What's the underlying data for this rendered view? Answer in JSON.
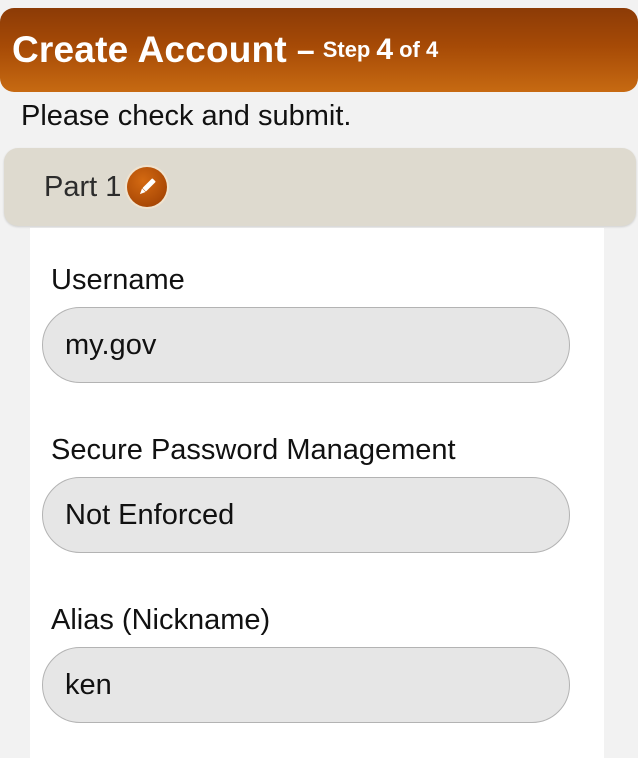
{
  "header": {
    "title": "Create Account",
    "dash": "–",
    "step_word": "Step",
    "step_current": "4",
    "step_of": "of 4"
  },
  "instructions": "Please check and submit.",
  "section": {
    "label": "Part 1",
    "edit_icon": "pencil-icon"
  },
  "fields": {
    "username": {
      "label": "Username",
      "value": "my.gov"
    },
    "password_mgmt": {
      "label": "Secure Password Management",
      "value": "Not Enforced"
    },
    "alias": {
      "label": "Alias (Nickname)",
      "value": "ken"
    }
  },
  "colors": {
    "header_top": "#8c3b06",
    "header_bottom": "#c76a12",
    "section_bar": "#dedacf",
    "field_bg": "#e6e6e6"
  }
}
